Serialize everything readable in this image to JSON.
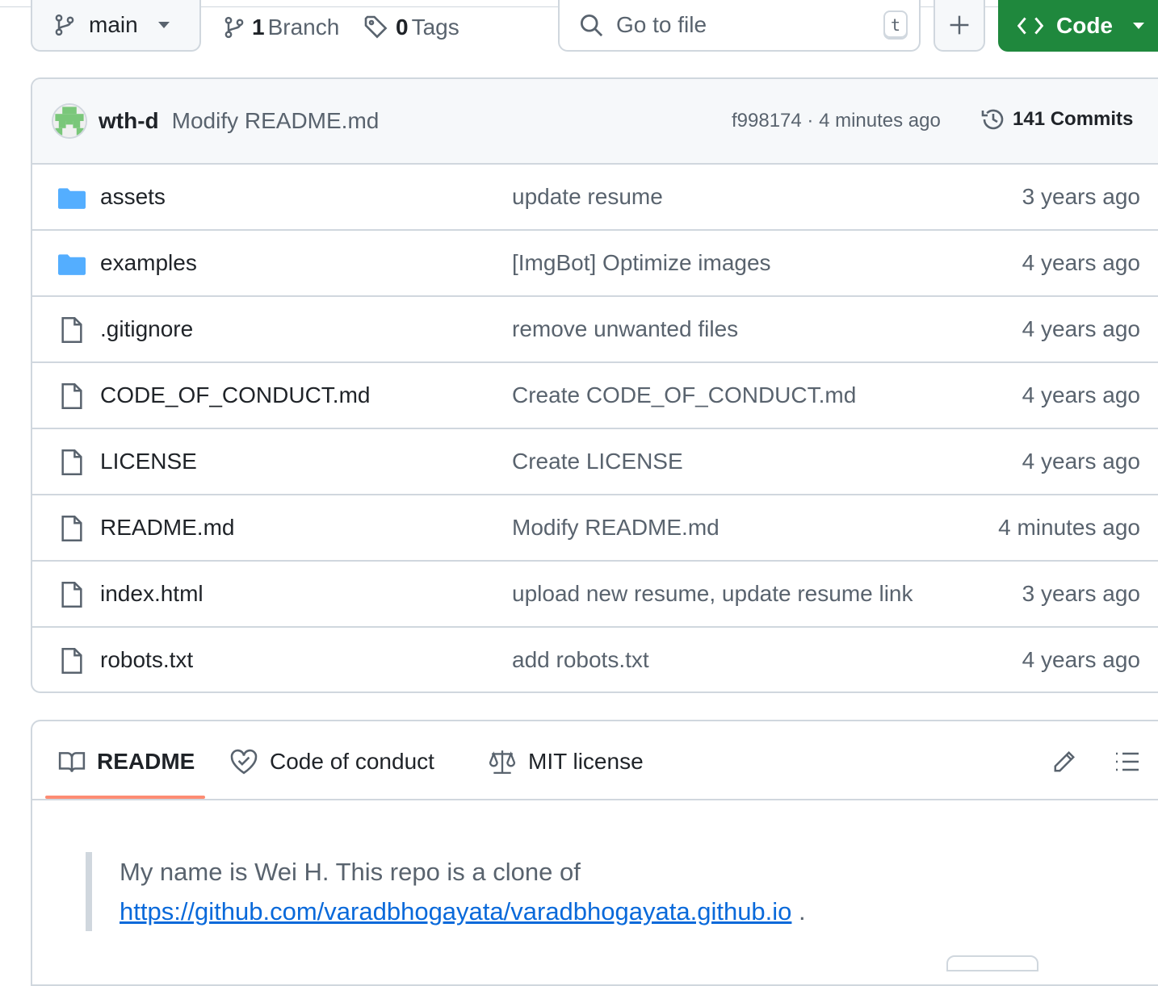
{
  "toolbar": {
    "branch_label": "main",
    "branch_count": "1",
    "branch_word": "Branch",
    "tag_count": "0",
    "tag_word": "Tags",
    "search_placeholder": "Go to file",
    "search_shortcut": "t",
    "code_label": "Code"
  },
  "commit": {
    "author": "wth-d",
    "message": "Modify README.md",
    "meta": "f998174 · 4 minutes ago",
    "commits_label": "141 Commits"
  },
  "files": [
    {
      "name": "assets",
      "type": "folder",
      "message": "update resume",
      "date": "3 years ago"
    },
    {
      "name": "examples",
      "type": "folder",
      "message": "[ImgBot] Optimize images",
      "date": "4 years ago"
    },
    {
      "name": ".gitignore",
      "type": "file",
      "message": "remove unwanted files",
      "date": "4 years ago"
    },
    {
      "name": "CODE_OF_CONDUCT.md",
      "type": "file",
      "message": "Create CODE_OF_CONDUCT.md",
      "date": "4 years ago"
    },
    {
      "name": "LICENSE",
      "type": "file",
      "message": "Create LICENSE",
      "date": "4 years ago"
    },
    {
      "name": "README.md",
      "type": "file",
      "message": "Modify README.md",
      "date": "4 minutes ago"
    },
    {
      "name": "index.html",
      "type": "file",
      "message": "upload new resume, update resume link",
      "date": "3 years ago"
    },
    {
      "name": "robots.txt",
      "type": "file",
      "message": "add robots.txt",
      "date": "4 years ago"
    }
  ],
  "readme": {
    "tabs": [
      "README",
      "Code of conduct",
      "MIT license"
    ],
    "body_text": "My name is Wei H. This repo is a clone of",
    "body_link": "https://github.com/varadbhogayata/varadbhogayata.github.io",
    "body_end": " ."
  },
  "colors": {
    "accent_green": "#1f883d",
    "folder_blue": "#54aeff",
    "link_blue": "#0969da",
    "tab_underline": "#fd8c73",
    "border": "#d0d7de"
  },
  "icons": {
    "branch": "git-branch-icon",
    "tag": "tag-icon",
    "search": "search-icon",
    "plus": "plus-icon",
    "code": "code-icon",
    "history": "history-icon",
    "folder": "folder-icon",
    "file": "file-icon",
    "book": "book-icon",
    "heart": "code-of-conduct-icon",
    "law": "law-icon",
    "pencil": "pencil-icon",
    "list": "list-icon"
  }
}
